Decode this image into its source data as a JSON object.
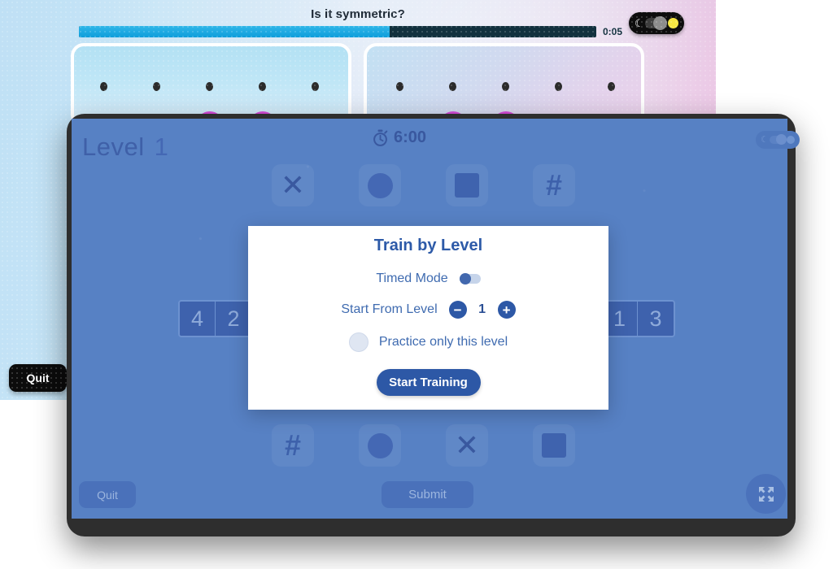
{
  "background_window": {
    "title": "Is it symmetric?",
    "progress": {
      "percent": 60,
      "time_label": "0:05"
    },
    "theme_toggle": {
      "moon_icon": "moon-icon",
      "sun_icon": "sun-icon",
      "state": "off"
    },
    "cards": [
      {
        "name": "left-symmetry-card",
        "dots": 5,
        "blobs": 2
      },
      {
        "name": "right-symmetry-card",
        "dots": 5,
        "blobs": 2
      }
    ],
    "quit_label": "Quit"
  },
  "game_window": {
    "level_label": "Level",
    "level_number": "1",
    "timer": {
      "icon": "stopwatch-icon",
      "value": "6:00"
    },
    "theme_toggle": {
      "moon_icon": "moon-icon",
      "sun_icon": "sun-icon",
      "state": "off"
    },
    "top_tiles": [
      {
        "icon": "x-icon",
        "glyph": "✕"
      },
      {
        "icon": "circle-icon",
        "glyph": ""
      },
      {
        "icon": "square-icon",
        "glyph": ""
      },
      {
        "icon": "hash-icon",
        "glyph": "#"
      }
    ],
    "bottom_tiles": [
      {
        "icon": "hash-icon",
        "glyph": "#"
      },
      {
        "icon": "circle-icon",
        "glyph": ""
      },
      {
        "icon": "x-icon",
        "glyph": "✕"
      },
      {
        "icon": "square-icon",
        "glyph": ""
      }
    ],
    "left_numbers": [
      "4",
      "2"
    ],
    "right_numbers": [
      "1",
      "3"
    ],
    "quit_label": "Quit",
    "submit_label": "Submit",
    "fullscreen_icon": "fullscreen-expand-icon"
  },
  "modal": {
    "title": "Train by Level",
    "timed_mode_label": "Timed Mode",
    "timed_mode_state": "off",
    "start_from_level_label": "Start From Level",
    "level_value": "1",
    "decrement_label": "−",
    "increment_label": "+",
    "practice_label": "Practice only this level",
    "practice_checked": false,
    "start_button_label": "Start Training"
  },
  "colors": {
    "accent_blue": "#2d58a6",
    "game_bg": "#5781c4",
    "progress_fill": "#0d9ddb",
    "progress_track": "#12313e",
    "blob_magenta": "#d44ad8"
  }
}
